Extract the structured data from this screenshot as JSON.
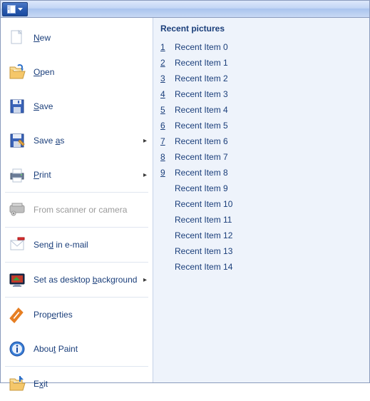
{
  "menu": {
    "items": [
      {
        "label_pre": "",
        "label_u": "N",
        "label_post": "ew",
        "icon": "new",
        "submenu": false,
        "disabled": false
      },
      {
        "label_pre": "",
        "label_u": "O",
        "label_post": "pen",
        "icon": "open",
        "submenu": false,
        "disabled": false
      },
      {
        "label_pre": "",
        "label_u": "S",
        "label_post": "ave",
        "icon": "save",
        "submenu": false,
        "disabled": false
      },
      {
        "label_pre": "Save ",
        "label_u": "a",
        "label_post": "s",
        "icon": "saveas",
        "submenu": true,
        "disabled": false
      },
      {
        "label_pre": "",
        "label_u": "P",
        "label_post": "rint",
        "icon": "print",
        "submenu": true,
        "disabled": false
      },
      {
        "label_pre": "From scanner or camera",
        "label_u": "",
        "label_post": "",
        "icon": "scanner",
        "submenu": false,
        "disabled": true
      },
      {
        "label_pre": "Sen",
        "label_u": "d",
        "label_post": " in e-mail",
        "icon": "email",
        "submenu": false,
        "disabled": false
      },
      {
        "label_pre": "Set as desktop ",
        "label_u": "b",
        "label_post": "ackground",
        "icon": "desktop",
        "submenu": true,
        "disabled": false
      },
      {
        "label_pre": "Prop",
        "label_u": "e",
        "label_post": "rties",
        "icon": "properties",
        "submenu": false,
        "disabled": false
      },
      {
        "label_pre": "Abou",
        "label_u": "t",
        "label_post": " Paint",
        "icon": "about",
        "submenu": false,
        "disabled": false
      },
      {
        "label_pre": "E",
        "label_u": "x",
        "label_post": "it",
        "icon": "exit",
        "submenu": false,
        "disabled": false
      }
    ]
  },
  "recent": {
    "header": "Recent pictures",
    "items": [
      {
        "num": "1",
        "label": "Recent Item 0"
      },
      {
        "num": "2",
        "label": "Recent Item 1"
      },
      {
        "num": "3",
        "label": "Recent Item 2"
      },
      {
        "num": "4",
        "label": "Recent Item 3"
      },
      {
        "num": "5",
        "label": "Recent Item 4"
      },
      {
        "num": "6",
        "label": "Recent Item 5"
      },
      {
        "num": "7",
        "label": "Recent Item 6"
      },
      {
        "num": "8",
        "label": "Recent Item 7"
      },
      {
        "num": "9",
        "label": "Recent Item 8"
      },
      {
        "num": "",
        "label": "Recent Item 9"
      },
      {
        "num": "",
        "label": "Recent Item 10"
      },
      {
        "num": "",
        "label": "Recent Item 11"
      },
      {
        "num": "",
        "label": "Recent Item 12"
      },
      {
        "num": "",
        "label": "Recent Item 13"
      },
      {
        "num": "",
        "label": "Recent Item 14"
      }
    ]
  }
}
